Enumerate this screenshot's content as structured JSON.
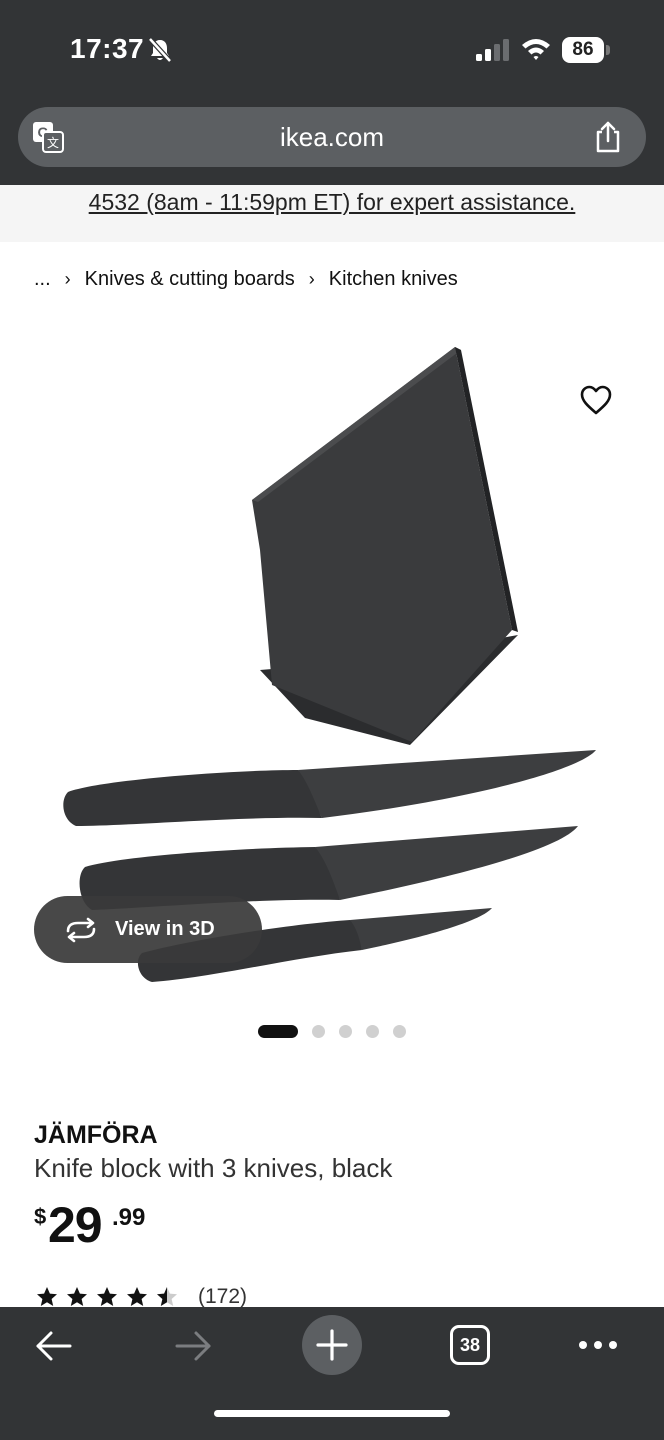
{
  "status_bar": {
    "time": "17:37",
    "battery": "86"
  },
  "browser": {
    "url": "ikea.com"
  },
  "banner": {
    "text": "4532 (8am - 11:59pm ET) for expert assistance."
  },
  "breadcrumb": {
    "ellipsis": "...",
    "items": [
      "Knives & cutting boards",
      "Kitchen knives"
    ]
  },
  "gallery": {
    "view3d_label": "View in 3D",
    "total_images": 5,
    "active_index": 0
  },
  "product": {
    "name": "JÄMFÖRA",
    "description": "Knife block with 3 knives, black",
    "price_currency": "$",
    "price_whole": "29",
    "price_cents": ".99",
    "rating_value": 4.5,
    "rating_max": 5,
    "rating_count": "(172)"
  },
  "toolbar": {
    "tab_count": "38"
  },
  "colors": {
    "chrome": "#323436",
    "urlbar": "#5c5f62",
    "banner_bg": "#f5f5f5"
  }
}
